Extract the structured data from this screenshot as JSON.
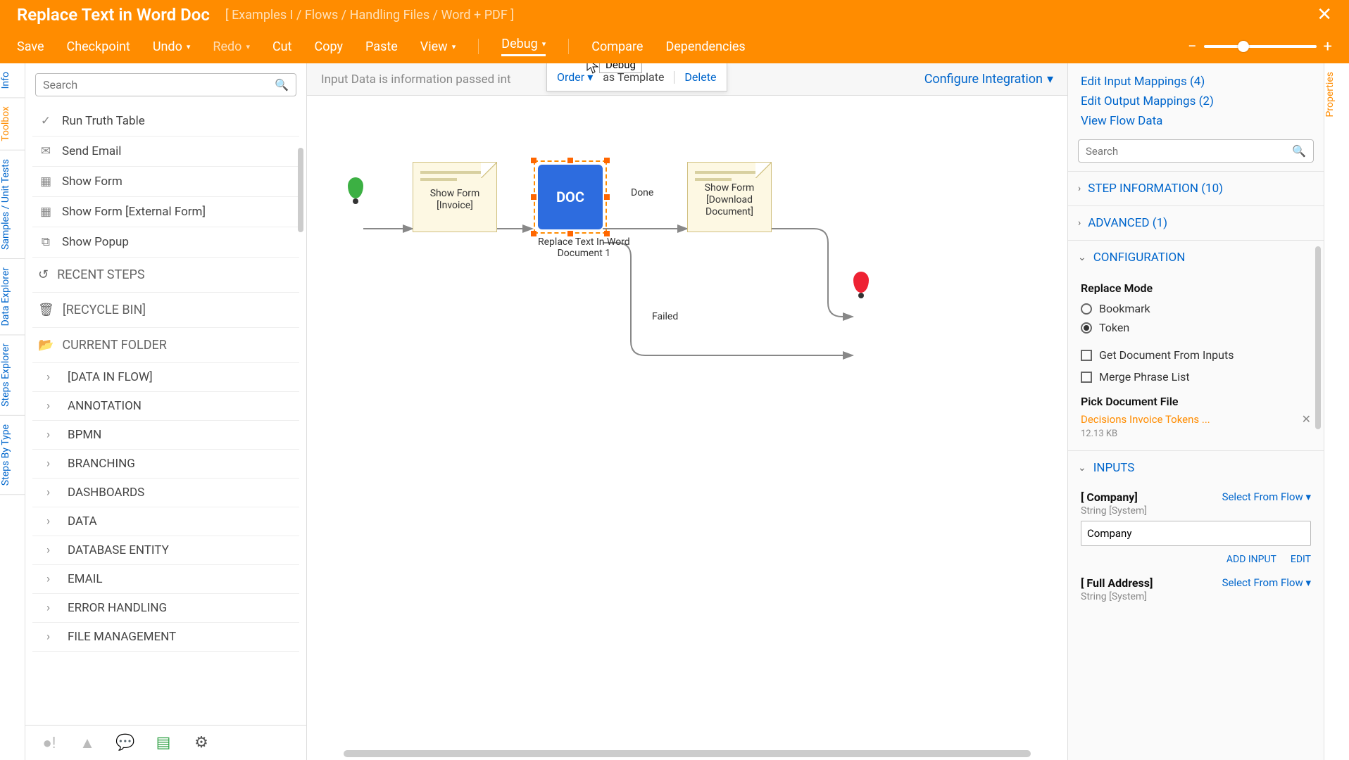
{
  "title": "Replace Text in Word Doc",
  "breadcrumb": "[ Examples I / Flows / Handling Files / Word + PDF ]",
  "menu": {
    "save": "Save",
    "checkpoint": "Checkpoint",
    "undo": "Undo",
    "redo": "Redo",
    "cut": "Cut",
    "copy": "Copy",
    "paste": "Paste",
    "view": "View",
    "debug": "Debug",
    "compare": "Compare",
    "dependencies": "Dependencies"
  },
  "debug_tooltip": "Debug",
  "popover": {
    "order": "Order",
    "as_template": "as Template",
    "delete": "Delete"
  },
  "left_tabs": [
    "Info",
    "Toolbox",
    "Samples / Unit Tests",
    "Data Explorer",
    "Steps Explorer",
    "Steps By Type"
  ],
  "right_tab": "Properties",
  "toolbox": {
    "search_placeholder": "Search",
    "quick_items": [
      {
        "label": "Run Truth Table",
        "icon": "✓"
      },
      {
        "label": "Send Email",
        "icon": "✉"
      },
      {
        "label": "Show Form",
        "icon": "▦"
      },
      {
        "label": "Show Form [External Form]",
        "icon": "▦"
      },
      {
        "label": "Show Popup",
        "icon": "⧉"
      }
    ],
    "recent": "RECENT STEPS",
    "recycle": "[RECYCLE BIN]",
    "current": "CURRENT FOLDER",
    "folders": [
      "[DATA IN FLOW]",
      "ANNOTATION",
      "BPMN",
      "BRANCHING",
      "DASHBOARDS",
      "DATA",
      "DATABASE ENTITY",
      "EMAIL",
      "ERROR HANDLING",
      "FILE MANAGEMENT"
    ]
  },
  "canvas": {
    "message": "Input Data is information passed int",
    "configure": "Configure Integration",
    "nodes": {
      "show_form_invoice": "Show Form\n[Invoice]",
      "doc_label": "DOC",
      "replace_text": "Replace Text In Word\nDocument 1",
      "show_form_download": "Show Form\n[Download\nDocument]"
    },
    "edges": {
      "done": "Done",
      "failed": "Failed"
    }
  },
  "right": {
    "links": [
      "Edit Input Mappings (4)",
      "Edit Output Mappings (2)",
      "View Flow Data"
    ],
    "search_placeholder": "Search",
    "step_info": "STEP INFORMATION (10)",
    "advanced": "ADVANCED (1)",
    "configuration": "CONFIGURATION",
    "replace_mode_label": "Replace Mode",
    "replace_modes": {
      "bookmark": "Bookmark",
      "token": "Token",
      "selected": "token"
    },
    "chk_get_doc": "Get Document From Inputs",
    "chk_merge": "Merge Phrase List",
    "pick_doc_label": "Pick Document File",
    "picked_file": {
      "name": "Decisions Invoice Tokens ...",
      "size": "12.13 KB"
    },
    "inputs_hdr": "INPUTS",
    "inputs": [
      {
        "label": "[ Company]",
        "type": "String [System]",
        "action": "Select From Flow",
        "value": "Company",
        "add": "ADD INPUT",
        "edit": "EDIT"
      },
      {
        "label": "[ Full Address]",
        "type": "String [System]",
        "action": "Select From Flow"
      }
    ]
  }
}
